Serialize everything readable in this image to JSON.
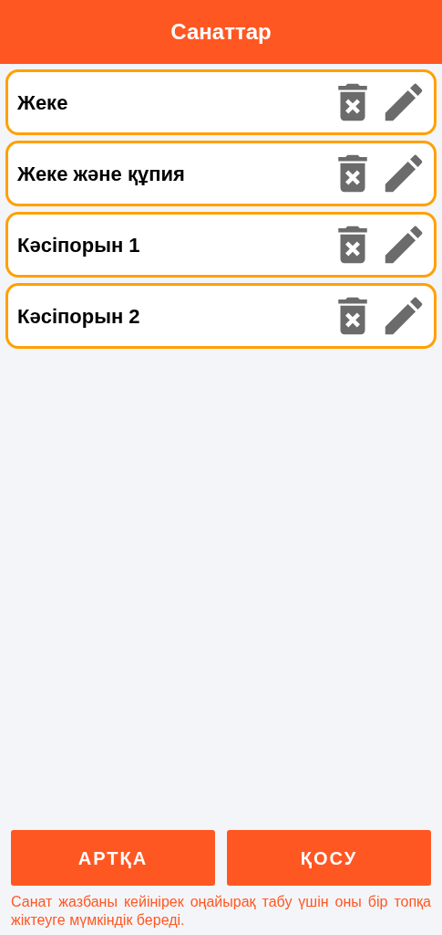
{
  "header": {
    "title": "Санаттар"
  },
  "categories": [
    {
      "name": "Жеке"
    },
    {
      "name": "Жеке және құпия"
    },
    {
      "name": "Кәсіпорын 1"
    },
    {
      "name": "Кәсіпорын 2"
    }
  ],
  "buttons": [
    "АРТҚА",
    "ҚОСУ"
  ],
  "note": "Санат жазбаны кейінірек оңайырақ табу үшін оны бір топқа жіктеуге мүмкіндік береді."
}
